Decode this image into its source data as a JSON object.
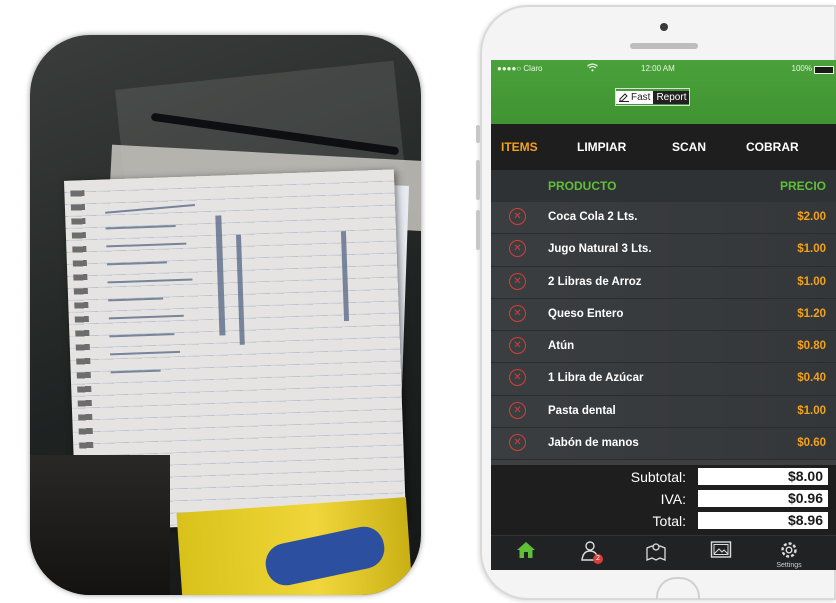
{
  "status_bar": {
    "carrier": "●●●●○ Claro",
    "time": "12:00 AM",
    "battery": "100%"
  },
  "logo": {
    "fast": "Fast",
    "report": "Report"
  },
  "menu": {
    "items": [
      "ITEMS",
      "LIMPIAR",
      "SCAN",
      "COBRAR"
    ],
    "active": "ITEMS"
  },
  "table": {
    "headers": {
      "product": "PRODUCTO",
      "price": "PRECIO"
    },
    "rows": [
      {
        "name": "Coca Cola 2 Lts.",
        "price": "$2.00"
      },
      {
        "name": "Jugo Natural 3 Lts.",
        "price": "$1.00"
      },
      {
        "name": "2 Libras de Arroz",
        "price": "$1.00"
      },
      {
        "name": "Queso Entero",
        "price": "$1.20"
      },
      {
        "name": "Atún",
        "price": "$0.80"
      },
      {
        "name": "1 Libra de Azúcar",
        "price": "$0.40"
      },
      {
        "name": "Pasta dental",
        "price": "$1.00"
      },
      {
        "name": "Jabón de manos",
        "price": "$0.60"
      }
    ]
  },
  "totals": {
    "subtotal_label": "Subtotal:",
    "subtotal": "$8.00",
    "iva_label": "IVA:",
    "iva": "$0.96",
    "total_label": "Total:",
    "total": "$8.96"
  },
  "tabbar": {
    "badge": "2",
    "settings_label": "Settings"
  },
  "colors": {
    "header_green": "#4aa13a",
    "accent_orange": "#f2a21c",
    "header_text_green": "#5fc038",
    "remove_red": "#d2403a"
  },
  "icons": [
    "home-icon",
    "user-icon",
    "map-icon",
    "image-icon",
    "gear-icon",
    "remove-icon"
  ]
}
